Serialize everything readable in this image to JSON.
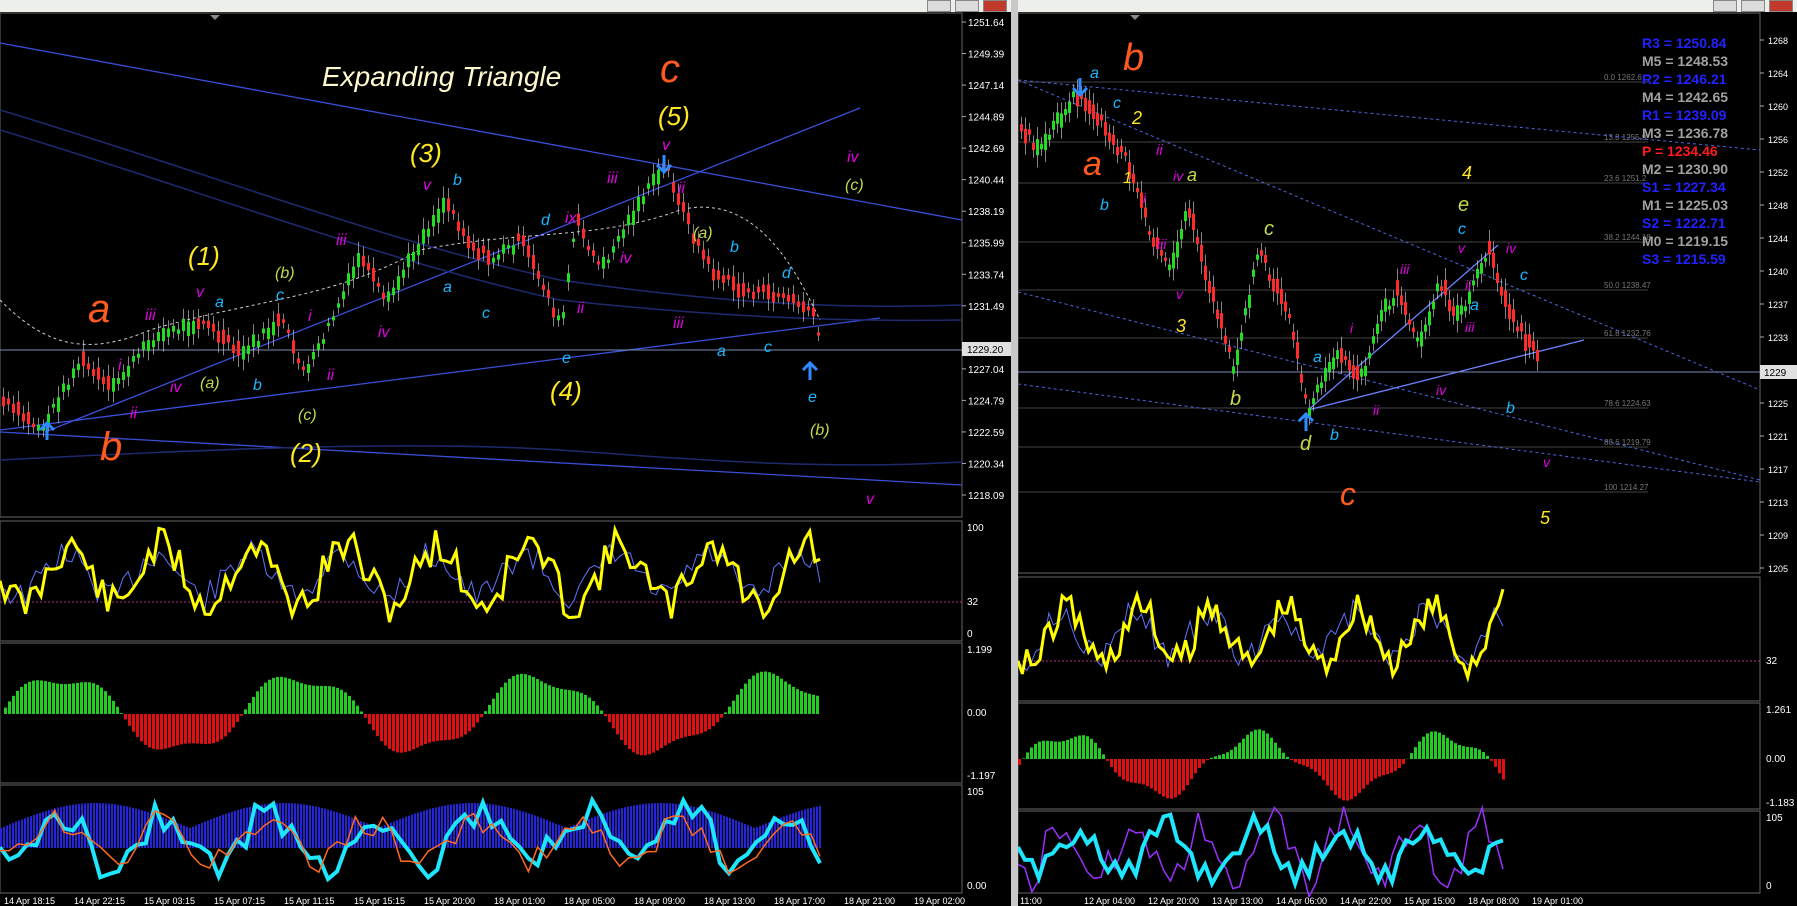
{
  "left_chart": {
    "title_annotation": "Expanding Triangle",
    "price_axis": [
      "1251.64",
      "1249.39",
      "1247.14",
      "1244.89",
      "1242.69",
      "1240.44",
      "1238.19",
      "1235.99",
      "1233.74",
      "1231.49",
      "1229.20",
      "1227.04",
      "1224.79",
      "1222.59",
      "1220.34",
      "1218.09"
    ],
    "current_price": "1229.20",
    "time_axis": [
      "14 Apr 18:15",
      "14 Apr 22:15",
      "15 Apr 03:15",
      "15 Apr 07:15",
      "15 Apr 11:15",
      "15 Apr 15:15",
      "15 Apr 20:00",
      "18 Apr 01:00",
      "18 Apr 05:00",
      "18 Apr 09:00",
      "18 Apr 13:00",
      "18 Apr 17:00",
      "18 Apr 21:00",
      "19 Apr 02:00"
    ],
    "wave_labels": {
      "a_big": "a",
      "b_big": "b",
      "c_big": "c",
      "w1": "(1)",
      "w2": "(2)",
      "w3": "(3)",
      "w4": "(4)",
      "w5": "(5)",
      "i": "i",
      "ii": "ii",
      "iii": "iii",
      "iv": "iv",
      "v": "v",
      "ix": "ix",
      "a": "a",
      "b": "b",
      "c": "c",
      "d": "d",
      "e": "e",
      "pa": "(a)",
      "pb": "(b)",
      "pc": "(c)"
    },
    "rsi_axis": [
      "100",
      "32",
      "0"
    ],
    "hist_axis": [
      "1.199",
      "0.00",
      "-1.197"
    ],
    "stoch_axis": [
      "105",
      "0.00"
    ]
  },
  "right_chart": {
    "pivot_levels": [
      {
        "label": "R3 = 1250.84",
        "color": "#2222ff"
      },
      {
        "label": "M5 = 1248.53",
        "color": "#a0a0a0"
      },
      {
        "label": "R2 = 1246.21",
        "color": "#2222ff"
      },
      {
        "label": "M4 = 1242.65",
        "color": "#a0a0a0"
      },
      {
        "label": "R1 = 1239.09",
        "color": "#2222ff"
      },
      {
        "label": "M3 = 1236.78",
        "color": "#a0a0a0"
      },
      {
        "label": "P = 1234.46",
        "color": "#ff1a1a"
      },
      {
        "label": "M2 = 1230.90",
        "color": "#a0a0a0"
      },
      {
        "label": "S1 = 1227.34",
        "color": "#2222ff"
      },
      {
        "label": "M1 = 1225.03",
        "color": "#a0a0a0"
      },
      {
        "label": "S2 = 1222.71",
        "color": "#2222ff"
      },
      {
        "label": "M0 = 1219.15",
        "color": "#a0a0a0"
      },
      {
        "label": "S3 = 1215.59",
        "color": "#2222ff"
      }
    ],
    "fib_levels": [
      "0.0 1262.6",
      "13.8 1255.9",
      "23.6 1251.2",
      "38.2 1244.18",
      "50.0 1238.47",
      "61.8 1232.76",
      "78.6 1224.63",
      "88.6 1219.79",
      "100 1214.27"
    ],
    "price_axis": [
      "1268",
      "1264",
      "1260",
      "1256",
      "1252",
      "1248",
      "1244",
      "1240",
      "1237",
      "1233",
      "1229",
      "1225",
      "1221",
      "1217",
      "1213",
      "1209",
      "1205"
    ],
    "current_price": "1229",
    "time_axis": [
      "11:00",
      "12 Apr 04:00",
      "12 Apr 20:00",
      "13 Apr 13:00",
      "14 Apr 06:00",
      "14 Apr 22:00",
      "15 Apr 15:00",
      "18 Apr 08:00",
      "19 Apr 01:00"
    ],
    "rsi_axis": [
      "32"
    ],
    "hist_axis": [
      "1.261",
      "0.00",
      "-1.183"
    ],
    "stoch_axis": [
      "105",
      "0"
    ]
  }
}
